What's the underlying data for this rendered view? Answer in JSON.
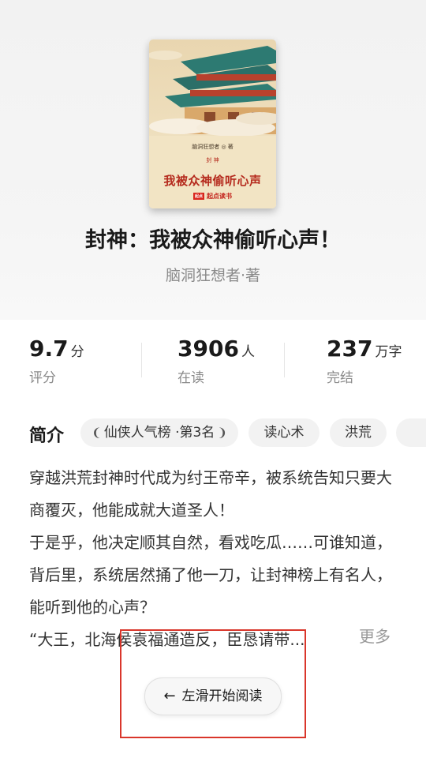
{
  "book": {
    "cover": {
      "author_line": "脑洞狂想者 ◎ 著",
      "seal_chars": "封 神",
      "title": "我被众神偷听心声",
      "brand_logo": "起点",
      "brand": "起点读书"
    },
    "title": "封神：我被众神偷听心声！",
    "author": "脑洞狂想者·著"
  },
  "stats": [
    {
      "value": "9.7",
      "unit": "分",
      "label": "评分"
    },
    {
      "value": "3906",
      "unit": "人",
      "label": "在读"
    },
    {
      "value": "237",
      "unit": "万字",
      "label": "完结"
    }
  ],
  "intro": {
    "label": "简介",
    "tags": [
      "仙侠人气榜 ·第3名",
      "读心术",
      "洪荒"
    ],
    "description": [
      "穿越洪荒封神时代成为纣王帝辛，被系统告知只要大商覆灭，他能成就大道圣人！",
      "于是乎，他决定顺其自然，看戏吃瓜……可谁知道，背后里，系统居然捅了他一刀，让封神榜上有名人，能听到他的心声？",
      "“大王，北海侯袁福通造反，臣恳请带..."
    ],
    "more": "更多"
  },
  "read_button": {
    "arrow": "←",
    "label": "左滑开始阅读"
  },
  "colors": {
    "annotation_box": "#d9362b",
    "cover_title": "#b52a1d"
  }
}
